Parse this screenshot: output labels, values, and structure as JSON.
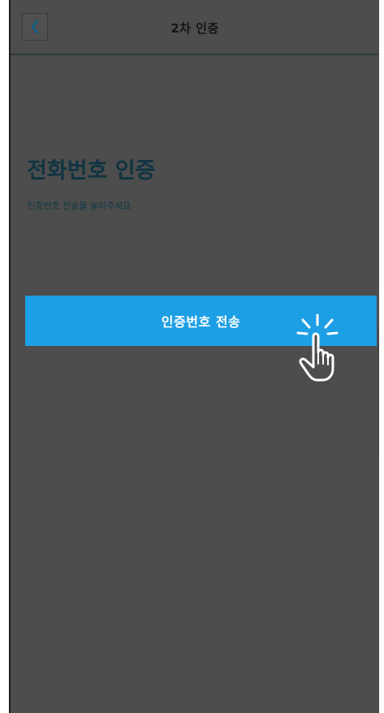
{
  "header": {
    "title": "2차 인증",
    "back_icon": "chevron-left-icon"
  },
  "content": {
    "title": "전화번호 인증",
    "subtitle": "인증번호 전송을 눌러주세요"
  },
  "send_button": {
    "label": "인증번호 전송"
  },
  "overlay": {
    "pointer_icon": "hand-pointer-click-icon"
  },
  "colors": {
    "overlay_bg": "#4d4d4d",
    "button_bg": "#1d9fe6",
    "title_color": "#0f3442"
  }
}
